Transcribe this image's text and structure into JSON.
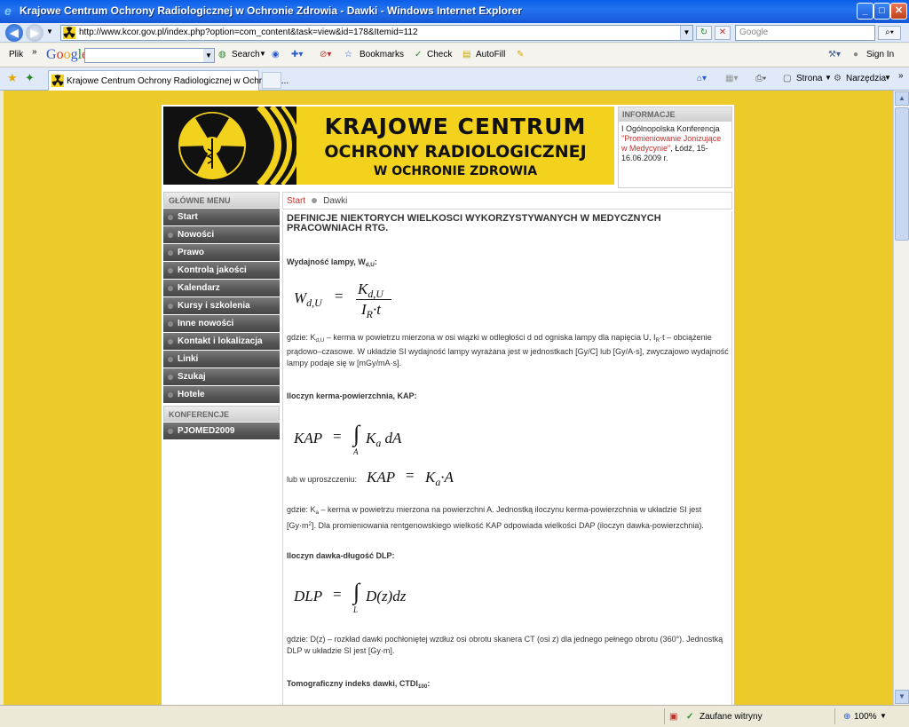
{
  "window": {
    "title": "Krajowe Centrum Ochrony Radiologicznej w Ochronie Zdrowia - Dawki - Windows Internet Explorer",
    "min_glyph": "_",
    "max_glyph": "□",
    "close_glyph": "✕"
  },
  "address_bar": {
    "url": "http://www.kcor.gov.pl/index.php?option=com_content&task=view&id=178&Itemid=112",
    "search_placeholder": "Google"
  },
  "google_toolbar": {
    "file_menu": "Plik",
    "chevrons": "»",
    "search_label": "Search",
    "bookmarks_label": "Bookmarks",
    "check_label": "Check",
    "autofill_label": "AutoFill",
    "sign_in_label": "Sign In"
  },
  "tabs": {
    "active_label": "Krajowe Centrum Ochrony Radiologicznej w Ochronie ...",
    "page_menu": "Strona",
    "tools_menu": "Narzędzia"
  },
  "banner": {
    "line1": "KRAJOWE CENTRUM",
    "line2": "OCHRONY RADIOLOGICZNEJ",
    "line3": "W OCHRONIE ZDROWIA"
  },
  "info": {
    "header": "INFORMACJE",
    "line1": "I Ogólnopolska Konferencja",
    "link": "\"Promieniowanie Jonizujące w Medycynie\"",
    "line2": ", Łódź, 15-16.06.2009 r."
  },
  "sidebar": {
    "main_header": "GŁÓWNE MENU",
    "items": [
      "Start",
      "Nowości",
      "Prawo",
      "Kontrola jakości",
      "Kalendarz",
      "Kursy i szkolenia",
      "Inne nowości",
      "Kontakt i lokalizacja",
      "Linki",
      "Szukaj",
      "Hotele"
    ],
    "conf_header": "KONFERENCJE",
    "conf_items": [
      "PJOMED2009"
    ]
  },
  "breadcrumb": {
    "home": "Start",
    "current": "Dawki"
  },
  "article": {
    "title": "DEFINICJE NIEKTORYCH WIELKOSCI WYKORZYSTYWANYCH W MEDYCZNYCH PRACOWNIACH RTG.",
    "s1_heading": "Wydajność lampy, W",
    "s1_heading_sub": "d,U",
    "s1_heading_end": ":",
    "s1_formula_lhs": "W",
    "s1_formula_lhs_sub": "d,U",
    "s1_formula_num": "K",
    "s1_formula_num_sub": "d,U",
    "s1_formula_den": "I",
    "s1_formula_den_sub": "R",
    "s1_formula_den_end": "·t",
    "s1_desc_a": "gdzie: K",
    "s1_desc_a_sub": "d,U",
    "s1_desc_b": " – kerma w powietrzu mierzona w osi wiązki w odległości d od ogniska lampy dla napięcia U, I",
    "s1_desc_b_sub": "R",
    "s1_desc_c": "·t – obciążenie prądowo–czasowe. W układzie SI wydajność lampy wyrażana jest w jednostkach [Gy/C] lub [Gy/A·s], zwyczajowo wydajność lampy podaje się w [mGy/mA·s].",
    "s2_heading": "Iloczyn kerma-powierzchnia, KAP:",
    "s2_formula_lhs": "KAP",
    "s2_formula_rhs": "K",
    "s2_formula_rhs_sub": "a",
    "s2_formula_rhs_end": "dA",
    "s2_int_sub": "A",
    "s2_simplified_label": "lub w uproszczeniu:",
    "s2_formula2_rhs": "K",
    "s2_formula2_rhs_sub": "a",
    "s2_formula2_rhs_end": "·A",
    "s2_desc_a": "gdzie: K",
    "s2_desc_a_sub": "a",
    "s2_desc_b": " – kerma w powietrzu mierzona na powierzchni A. Jednostką iloczynu kerma-powierzchnia w układzie SI jest [Gy·m",
    "s2_desc_b_sup": "2",
    "s2_desc_c": "]. Dla promieniowania rentgenowskiego wielkość KAP odpowiada wielkości DAP (iloczyn dawka-powierzchnia).",
    "s3_heading": "Iloczyn dawka-długość DLP:",
    "s3_formula_lhs": "DLP",
    "s3_formula_rhs": "D(z)dz",
    "s3_int_sub": "L",
    "s3_desc": "gdzie: D(z) – rozkład dawki pochłoniętej wzdłuż osi obrotu skanera CT (osi z) dla jednego pełnego obrotu (360°). Jednostką DLP w układzie SI jest [Gy·m].",
    "s4_heading": "Tomograficzny indeks dawki, CTDI",
    "s4_heading_sub": "100",
    "s4_heading_end": ":",
    "equals": "=",
    "integral": "∫"
  },
  "statusbar": {
    "zone": "Zaufane witryny",
    "zoom": "100%"
  },
  "colors": {
    "page_bg": "#ecca2a",
    "banner_yellow": "#f3d21e",
    "accent_red": "#c0302c",
    "menu_gray": "#555555"
  }
}
